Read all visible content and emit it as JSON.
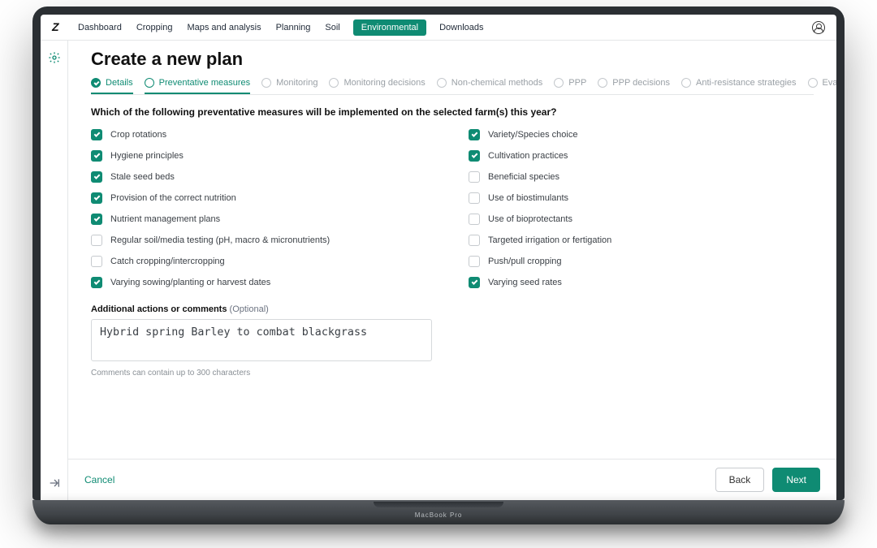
{
  "brand_mark": "MacBook Pro",
  "nav": {
    "items": [
      "Dashboard",
      "Cropping",
      "Maps and analysis",
      "Planning",
      "Soil",
      "Environmental",
      "Downloads"
    ],
    "active_index": 5
  },
  "page": {
    "title": "Create a new plan",
    "question": "Which of the following preventative measures will be implemented on the selected farm(s) this year?"
  },
  "steps": [
    {
      "label": "Details",
      "state": "done"
    },
    {
      "label": "Preventative measures",
      "state": "active"
    },
    {
      "label": "Monitoring",
      "state": "pending"
    },
    {
      "label": "Monitoring decisions",
      "state": "pending"
    },
    {
      "label": "Non-chemical methods",
      "state": "pending"
    },
    {
      "label": "PPP",
      "state": "pending"
    },
    {
      "label": "PPP decisions",
      "state": "pending"
    },
    {
      "label": "Anti-resistance strategies",
      "state": "pending"
    },
    {
      "label": "Evaluation",
      "state": "pending"
    }
  ],
  "measures_left": [
    {
      "label": "Crop rotations",
      "checked": true
    },
    {
      "label": "Hygiene principles",
      "checked": true
    },
    {
      "label": "Stale seed beds",
      "checked": true
    },
    {
      "label": "Provision of the correct nutrition",
      "checked": true
    },
    {
      "label": "Nutrient management plans",
      "checked": true
    },
    {
      "label": "Regular soil/media testing (pH, macro & micronutrients)",
      "checked": false
    },
    {
      "label": "Catch cropping/intercropping",
      "checked": false
    },
    {
      "label": "Varying sowing/planting or harvest dates",
      "checked": true
    }
  ],
  "measures_right": [
    {
      "label": "Variety/Species choice",
      "checked": true
    },
    {
      "label": "Cultivation practices",
      "checked": true
    },
    {
      "label": "Beneficial species",
      "checked": false
    },
    {
      "label": "Use of biostimulants",
      "checked": false
    },
    {
      "label": "Use of bioprotectants",
      "checked": false
    },
    {
      "label": "Targeted irrigation or fertigation",
      "checked": false
    },
    {
      "label": "Push/pull cropping",
      "checked": false
    },
    {
      "label": "Varying seed rates",
      "checked": true
    }
  ],
  "comments": {
    "label": "Additional actions or comments",
    "optional": "(Optional)",
    "value": "Hybrid spring Barley to combat blackgrass",
    "hint": "Comments can contain up to 300 characters"
  },
  "footer": {
    "cancel": "Cancel",
    "back": "Back",
    "next": "Next"
  }
}
